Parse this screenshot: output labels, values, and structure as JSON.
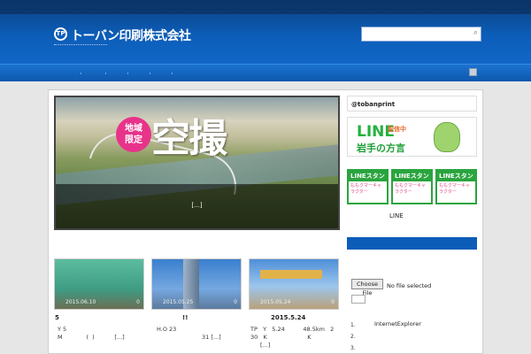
{
  "header": {
    "logo_mark": "TP",
    "company_name": "トーバン印刷株式会社",
    "search_icon": "search-icon"
  },
  "slider": {
    "badge": "地域\n限定",
    "title": "空撮",
    "caption": "[...]"
  },
  "posts": [
    {
      "date": "2015.06.10",
      "comments": "0",
      "title": "5",
      "line1": "Y   5",
      "line2": "M             (  )           [...]"
    },
    {
      "date": "2015.05.25",
      "comments": "0",
      "title": "!!",
      "line1": "H.O   23",
      "line2": "31       [...]"
    },
    {
      "date": "2015.05.24",
      "comments": "0",
      "title": "2015.5.24",
      "line1": "TP   Y   5.24          48.5km   2",
      "line2": "30   K                      K"
    }
  ],
  "posts_more": "[...]",
  "sidebar": {
    "twitter": "@tobanprint",
    "line_logo": "LINE",
    "line_tag": "配信中",
    "line_sub": "岩手の方言",
    "stamps": [
      {
        "head": "LINEスタンプ",
        "sub": "ももクマーキャラクター"
      },
      {
        "head": "LINEスタンプ",
        "sub": "ももクマーキャラクター"
      },
      {
        "head": "LINEスタンプ",
        "sub": "ももクマーキャラクター"
      }
    ],
    "line_caption": "LINE",
    "file_button": "Choose File",
    "file_text": "No file selected",
    "list": [
      "1.",
      "2.",
      "3."
    ],
    "ie_text": "InternetExplorer"
  }
}
